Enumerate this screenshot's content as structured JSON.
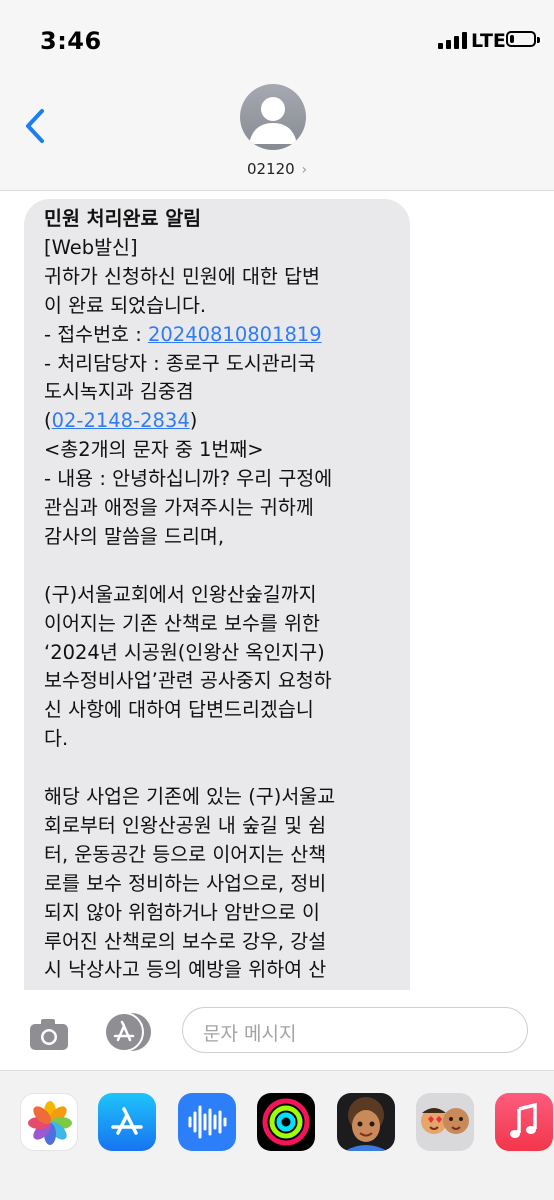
{
  "status_bar": {
    "time": "3:46",
    "network": "LTE",
    "battery_level": 0.2,
    "signal_bars": 4
  },
  "header": {
    "back_icon": "chevron-left-icon",
    "avatar_icon": "person-icon",
    "contact": "02120",
    "contact_chevron": "›"
  },
  "message": {
    "lines": [
      {
        "text": "민원 처리완료 알림",
        "bold": true
      },
      {
        "text": "[Web발신]"
      },
      {
        "text": "귀하가 신청하신 민원에 대한 답변"
      },
      {
        "text": "이 완료 되었습니다."
      },
      {
        "prefix": "- 접수번호 : ",
        "link": "20240810801819",
        "suffix": ""
      },
      {
        "text": "- 처리담당자 : 종로구 도시관리국"
      },
      {
        "text": "도시녹지과 김중겸"
      },
      {
        "prefix": "(",
        "link": "02-2148-2834",
        "suffix": ")"
      },
      {
        "text": "<총2개의 문자 중 1번째>"
      },
      {
        "text": "- 내용 : 안녕하십니까? 우리 구정에"
      },
      {
        "text": "관심과 애정을 가져주시는 귀하께"
      },
      {
        "text": "감사의 말씀을 드리며,"
      },
      {
        "text": ""
      },
      {
        "text": "(구)서울교회에서 인왕산숲길까지"
      },
      {
        "text": "이어지는 기존 산책로 보수를 위한"
      },
      {
        "text": "‘2024년 시공원(인왕산 옥인지구)"
      },
      {
        "text": "보수정비사업’관련 공사중지 요청하"
      },
      {
        "text": "신 사항에 대하여 답변드리겠습니"
      },
      {
        "text": "다."
      },
      {
        "text": ""
      },
      {
        "text": "해당 사업은 기존에 있는 (구)서울교"
      },
      {
        "text": "회로부터 인왕산공원 내 숲길 및 쉼"
      },
      {
        "text": "터, 운동공간 등으로 이어지는 산책"
      },
      {
        "text": "로를 보수 정비하는 사업으로, 정비"
      },
      {
        "text": "되지 않아 위험하거나 암반으로 이"
      },
      {
        "text": "루어진 산책로의 보수로 강우, 강설"
      },
      {
        "text": "시 낙상사고 등의 예방을 위하여 산"
      }
    ]
  },
  "input_bar": {
    "camera_icon": "camera-icon",
    "apps_icon": "app-store-icon",
    "placeholder": "문자 메시지",
    "mic_icon": "microphone-icon"
  },
  "app_drawer": {
    "apps": [
      "photos",
      "app-store",
      "audio-message",
      "fitness-activity",
      "memoji",
      "memoji-stickers",
      "music"
    ]
  },
  "colors": {
    "link": "#2f7cf6",
    "bubble": "#e9e9eb",
    "accent": "#1a7ff5",
    "battery": "#000000"
  }
}
